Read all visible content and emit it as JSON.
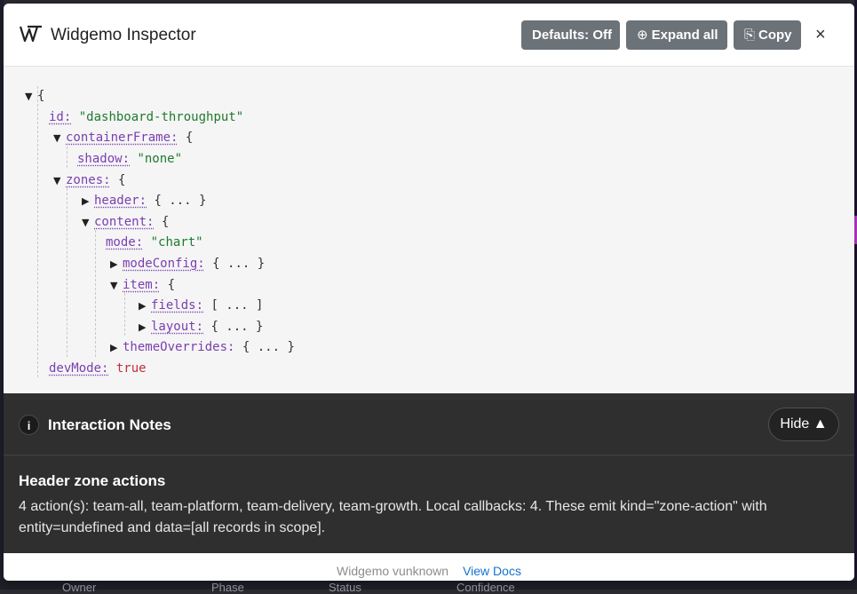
{
  "header": {
    "title": "Widgemo Inspector",
    "defaults_button": "Defaults: Off",
    "expand_button": "Expand all",
    "copy_button": "Copy",
    "close_symbol": "×"
  },
  "tree": {
    "open_brace": "{",
    "id_key": "id:",
    "id_value": "\"dashboard-throughput\"",
    "containerFrame_key": "containerFrame:",
    "shadow_key": "shadow:",
    "shadow_value": "\"none\"",
    "zones_key": "zones:",
    "header_key": "header:",
    "content_key": "content:",
    "mode_key": "mode:",
    "mode_value": "\"chart\"",
    "modeConfig_key": "modeConfig:",
    "item_key": "item:",
    "fields_key": "fields:",
    "layout_key": "layout:",
    "themeOverrides_key": "themeOverrides:",
    "devMode_key": "devMode:",
    "devMode_value": "true",
    "collapsed_object": "{ ... }",
    "collapsed_array": "[ ... ]",
    "brace": "{"
  },
  "notes": {
    "title": "Interaction Notes",
    "hide_button": "Hide ▲",
    "heading": "Header zone actions",
    "body": "4 action(s): team-all, team-platform, team-delivery, team-growth. Local callbacks: 4. These emit kind=\"zone-action\" with entity=undefined and data=[all records in scope]."
  },
  "footer": {
    "version": "Widgemo vunknown",
    "docs_link": "View Docs"
  },
  "background": {
    "col1": "Owner",
    "col2": "Phase",
    "col3": "Status",
    "col4": "Confidence"
  },
  "colors": {
    "button_bg": "#6b7278",
    "key": "#7a3fb0",
    "string": "#1f7a2e",
    "boolean": "#c0303a",
    "link": "#1473d0",
    "notes_bg": "#2f2f2f"
  },
  "icons": [
    "widgemo-logo-icon",
    "expand-icon",
    "copy-icon",
    "close-icon",
    "info-icon",
    "caret-down-icon",
    "caret-right-icon"
  ]
}
